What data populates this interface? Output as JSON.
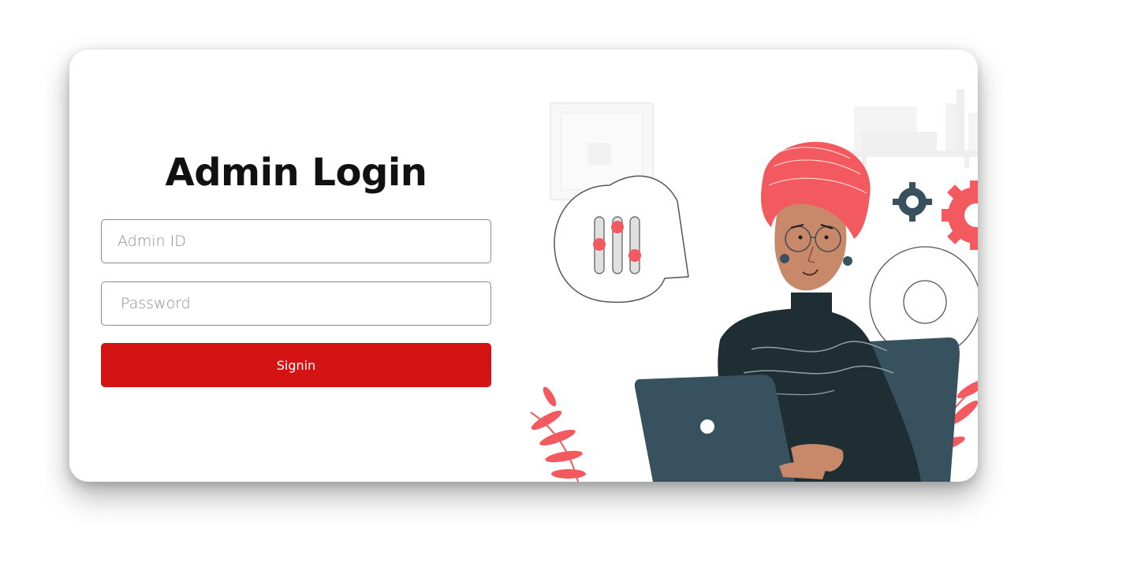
{
  "login": {
    "title": "Admin Login",
    "admin_id_placeholder": "Admin ID",
    "password_placeholder": "Password",
    "submit_label": "Signin"
  },
  "illustration": {
    "icon": "admin-working-on-laptop-illustration",
    "accent_color": "#f25a5f",
    "dark_color": "#37525e"
  },
  "colors": {
    "primary_button": "#d41414",
    "title_text": "#111111"
  }
}
